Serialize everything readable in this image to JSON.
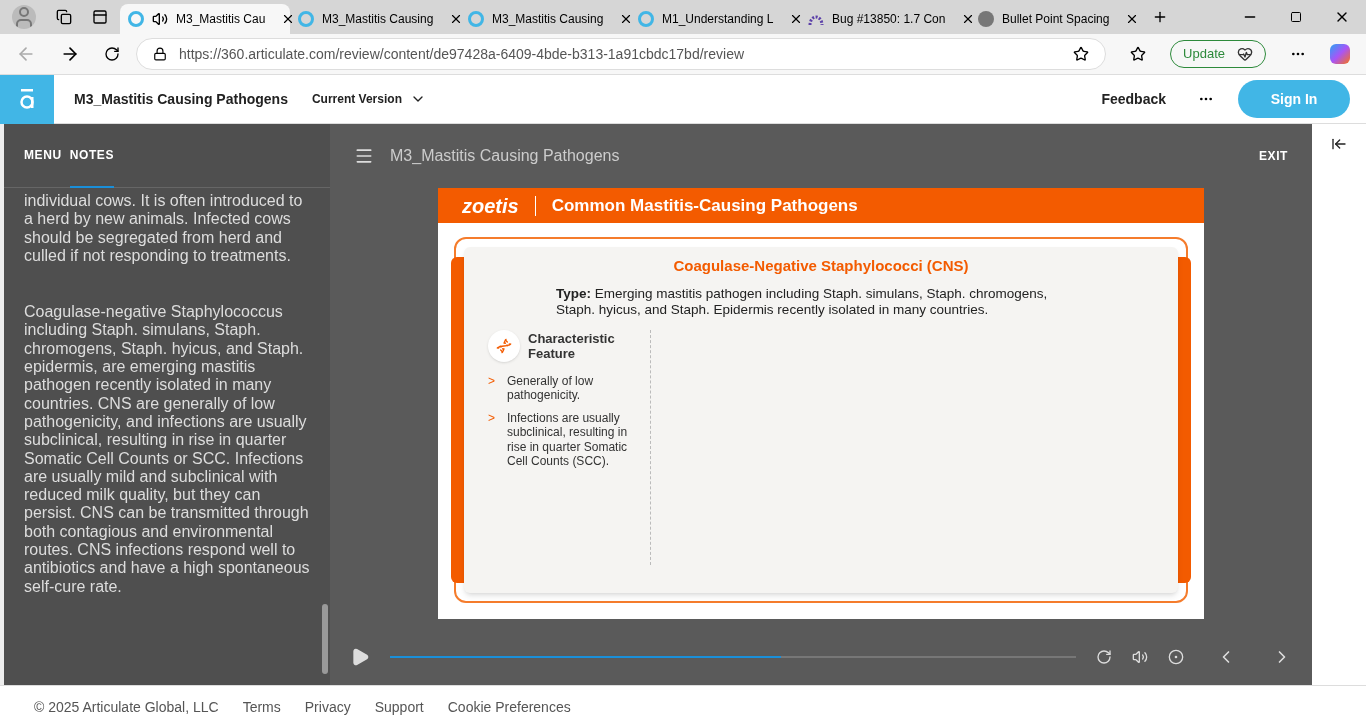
{
  "browser": {
    "tabs": [
      {
        "title": "M3_Mastitis Cau",
        "selected": true,
        "audio": true,
        "kind": "articulate"
      },
      {
        "title": "M3_Mastitis Causing",
        "selected": false,
        "audio": false,
        "kind": "articulate"
      },
      {
        "title": "M3_Mastitis Causing",
        "selected": false,
        "audio": false,
        "kind": "articulate"
      },
      {
        "title": "M1_Understanding L",
        "selected": false,
        "audio": false,
        "kind": "articulate"
      },
      {
        "title": "Bug #13850: 1.7 Con",
        "selected": false,
        "audio": false,
        "kind": "arch"
      },
      {
        "title": "Bullet Point Spacing",
        "selected": false,
        "audio": false,
        "kind": "gpt"
      }
    ],
    "url": "https://360.articulate.com/review/content/de97428a-6409-4bde-b313-1a91cbdc17bd/review",
    "update_label": "Update"
  },
  "header": {
    "title": "M3_Mastitis Causing Pathogens",
    "version": "Current Version",
    "feedback": "Feedback",
    "sign_in": "Sign In"
  },
  "sidebar": {
    "tabs": [
      {
        "label": "MENU",
        "selected": false
      },
      {
        "label": "NOTES",
        "selected": true
      }
    ],
    "notes": [
      "individual cows. It is often introduced to a herd by new animals. Infected cows should be segregated from herd and culled if not responding to treatments.",
      "Coagulase-negative Staphylococcus including Staph. simulans, Staph. chromogens, Staph. hyicus, and Staph. epidermis, are emerging mastitis pathogen recently isolated in many countries. CNS are generally of low pathogenicity, and infections are usually subclinical, resulting in rise in quarter Somatic Cell Counts or SCC. Infections are usually mild and subclinical with reduced milk quality, but they can persist. CNS can be transmitted through both contagious and environmental routes. CNS infections respond well to antibiotics and have a high spontaneous self-cure rate."
    ]
  },
  "player": {
    "title": "M3_Mastitis Causing Pathogens",
    "exit": "EXIT",
    "level": 0.57
  },
  "slide": {
    "brand": "zoetis",
    "title": "Common Mastitis-Causing Pathogens",
    "card_title": "Coagulase-Negative Staphylococci (CNS)",
    "type_text": "**Type:** Emerging mastitis pathogen including Staph. simulans, Staph. chromogens, Staph. hyicus, and Staph. Epidermis recently isolated in many countries.",
    "feature_title": "Characteristic Feature",
    "bullet_mark": ">",
    "bullets": [
      "Generally of low pathogenicity.",
      "Infections are usually subclinical, resulting in rise in quarter Somatic Cell Counts (SCC)."
    ]
  },
  "footer": {
    "copyright": "© 2025 Articulate Global, LLC",
    "links": [
      "Terms",
      "Privacy",
      "Support",
      "Cookie Preferences"
    ]
  }
}
